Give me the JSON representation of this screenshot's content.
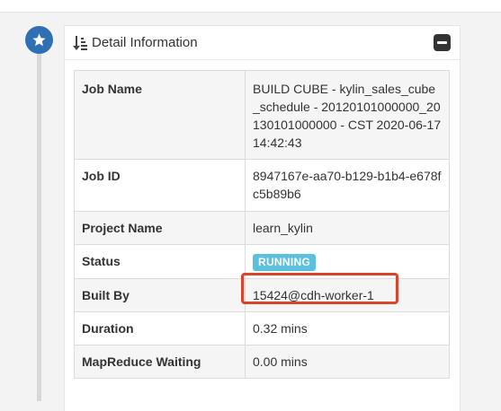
{
  "panel": {
    "title": "Detail Information",
    "icons": {
      "timeline_badge": "star-icon",
      "header": "sort-amount-down-icon",
      "collapse": "minus-square-icon"
    }
  },
  "details": {
    "job_name": {
      "label": "Job Name",
      "value": "BUILD CUBE - kylin_sales_cube_schedule - 20120101000000_20130101000000 - CST 2020-06-17 14:42:43"
    },
    "job_id": {
      "label": "Job ID",
      "value": "8947167e-aa70-b129-b1b4-e678fc5b89b6"
    },
    "project_name": {
      "label": "Project Name",
      "value": "learn_kylin"
    },
    "status": {
      "label": "Status",
      "value": "RUNNING"
    },
    "built_by": {
      "label": "Built By",
      "value": "15424@cdh-worker-1"
    },
    "duration": {
      "label": "Duration",
      "value": "0.32 mins"
    },
    "mapreduce_waiting": {
      "label": "MapReduce Waiting",
      "value": "0.00 mins"
    }
  },
  "colors": {
    "timeline_badge": "#2f6fb3",
    "status_running": "#5bc0de",
    "highlight": "#d9452b"
  }
}
